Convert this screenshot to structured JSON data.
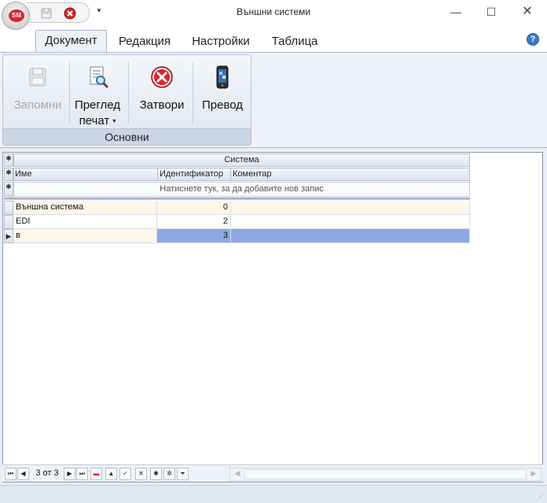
{
  "window": {
    "title": "Външни системи",
    "app_badge": "SM",
    "minimize_glyph": "—",
    "maximize_glyph": "☐",
    "close_glyph": "✕",
    "qat_dropdown_glyph": "▾"
  },
  "tabs": [
    {
      "label": "Документ",
      "active": true
    },
    {
      "label": "Редакция",
      "active": false
    },
    {
      "label": "Настройки",
      "active": false
    },
    {
      "label": "Таблица",
      "active": false
    }
  ],
  "help_glyph": "?",
  "ribbon": {
    "group_caption": "Основни",
    "buttons": {
      "save": {
        "label": "Запомни",
        "enabled": false,
        "icon": "floppy-icon"
      },
      "preview_line1": "Преглед",
      "preview_line2": "печат",
      "preview_caret": "▾",
      "close": {
        "label": "Затвори",
        "icon": "close-icon"
      },
      "translate": {
        "label": "Превод",
        "icon": "phone-icon"
      }
    }
  },
  "grid": {
    "band_header": "Система",
    "columns": [
      "Име",
      "Идентификатор",
      "Коментар"
    ],
    "new_row_prompt": "Натиснете тук, за да добавите нов запис",
    "indicator_glyph": "✱",
    "current_row_glyph": "▶",
    "rows": [
      {
        "name": "Външна система",
        "id": "0",
        "comment": ""
      },
      {
        "name": "EDI",
        "id": "2",
        "comment": ""
      },
      {
        "name": "в",
        "id": "3",
        "comment": "",
        "selected": true
      }
    ]
  },
  "navigator": {
    "record_info": "3 от 3",
    "buttons": [
      "⏮",
      "◀",
      "▶",
      "⏭",
      "▬",
      "▲",
      "✔",
      "✖",
      "✱",
      "✲",
      "⏷"
    ]
  },
  "colors": {
    "selection": "#8ea9e2",
    "accent": "#3c7ac6",
    "close_red": "#d9262b"
  }
}
